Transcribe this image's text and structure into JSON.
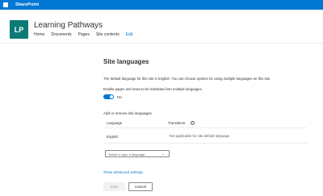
{
  "suite_bar": {
    "app_name": "SharePoint",
    "waffle_icon": "waffle-icon",
    "color": "#0078d4"
  },
  "site": {
    "logo_text": "LP",
    "logo_color": "#0b7a75",
    "title": "Learning Pathways",
    "nav": [
      "Home",
      "Documents",
      "Pages",
      "Site contents",
      "Edit"
    ]
  },
  "settings": {
    "title": "Site languages",
    "description": "The default language for this site is English. You can choose options for using multiple languages on this site.",
    "toggle_label": "Enable pages and news to be translated into multiple languages",
    "toggle_state": "On",
    "toggle_on": true,
    "add_remove_label": "Add or remove site languages",
    "table": {
      "headers": [
        "Language",
        "Translators"
      ],
      "info_icon": "info-icon",
      "rows": [
        {
          "language": "English",
          "translators": "Not applicable for site default language"
        }
      ]
    },
    "language_picker_placeholder": "Select or type a language",
    "show_advanced_label": "Show advanced settings",
    "save_label": "Save",
    "cancel_label": "Cancel"
  }
}
